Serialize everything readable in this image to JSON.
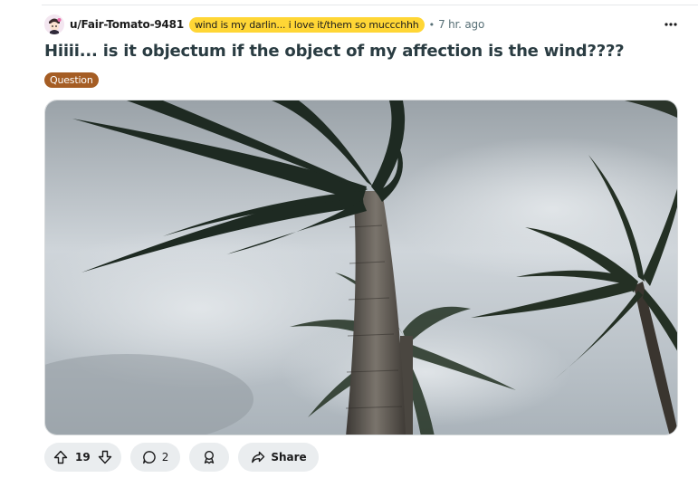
{
  "post": {
    "author": "u/Fair-Tomato-9481",
    "user_flair": "wind is my darlin... i love it/them so muccchhh",
    "separator": "•",
    "time": "7 hr. ago",
    "title": "Hiiii... is it objectum if the object of my affection is the wind????",
    "post_flair": "Question",
    "image_description": "palm-trees-in-wind"
  },
  "actions": {
    "upvotes": "19",
    "comments": "2",
    "share_label": "Share"
  },
  "colors": {
    "user_flair_bg": "#ffd635",
    "post_flair_bg": "#a55d24",
    "pill_bg": "#eaedef",
    "title_color": "#2a3c42"
  },
  "icons": {
    "more": "more-horizontal-icon",
    "upvote": "upvote-arrow-icon",
    "downvote": "downvote-arrow-icon",
    "comment": "comment-bubble-icon",
    "award": "award-icon",
    "share": "share-arrow-icon"
  }
}
